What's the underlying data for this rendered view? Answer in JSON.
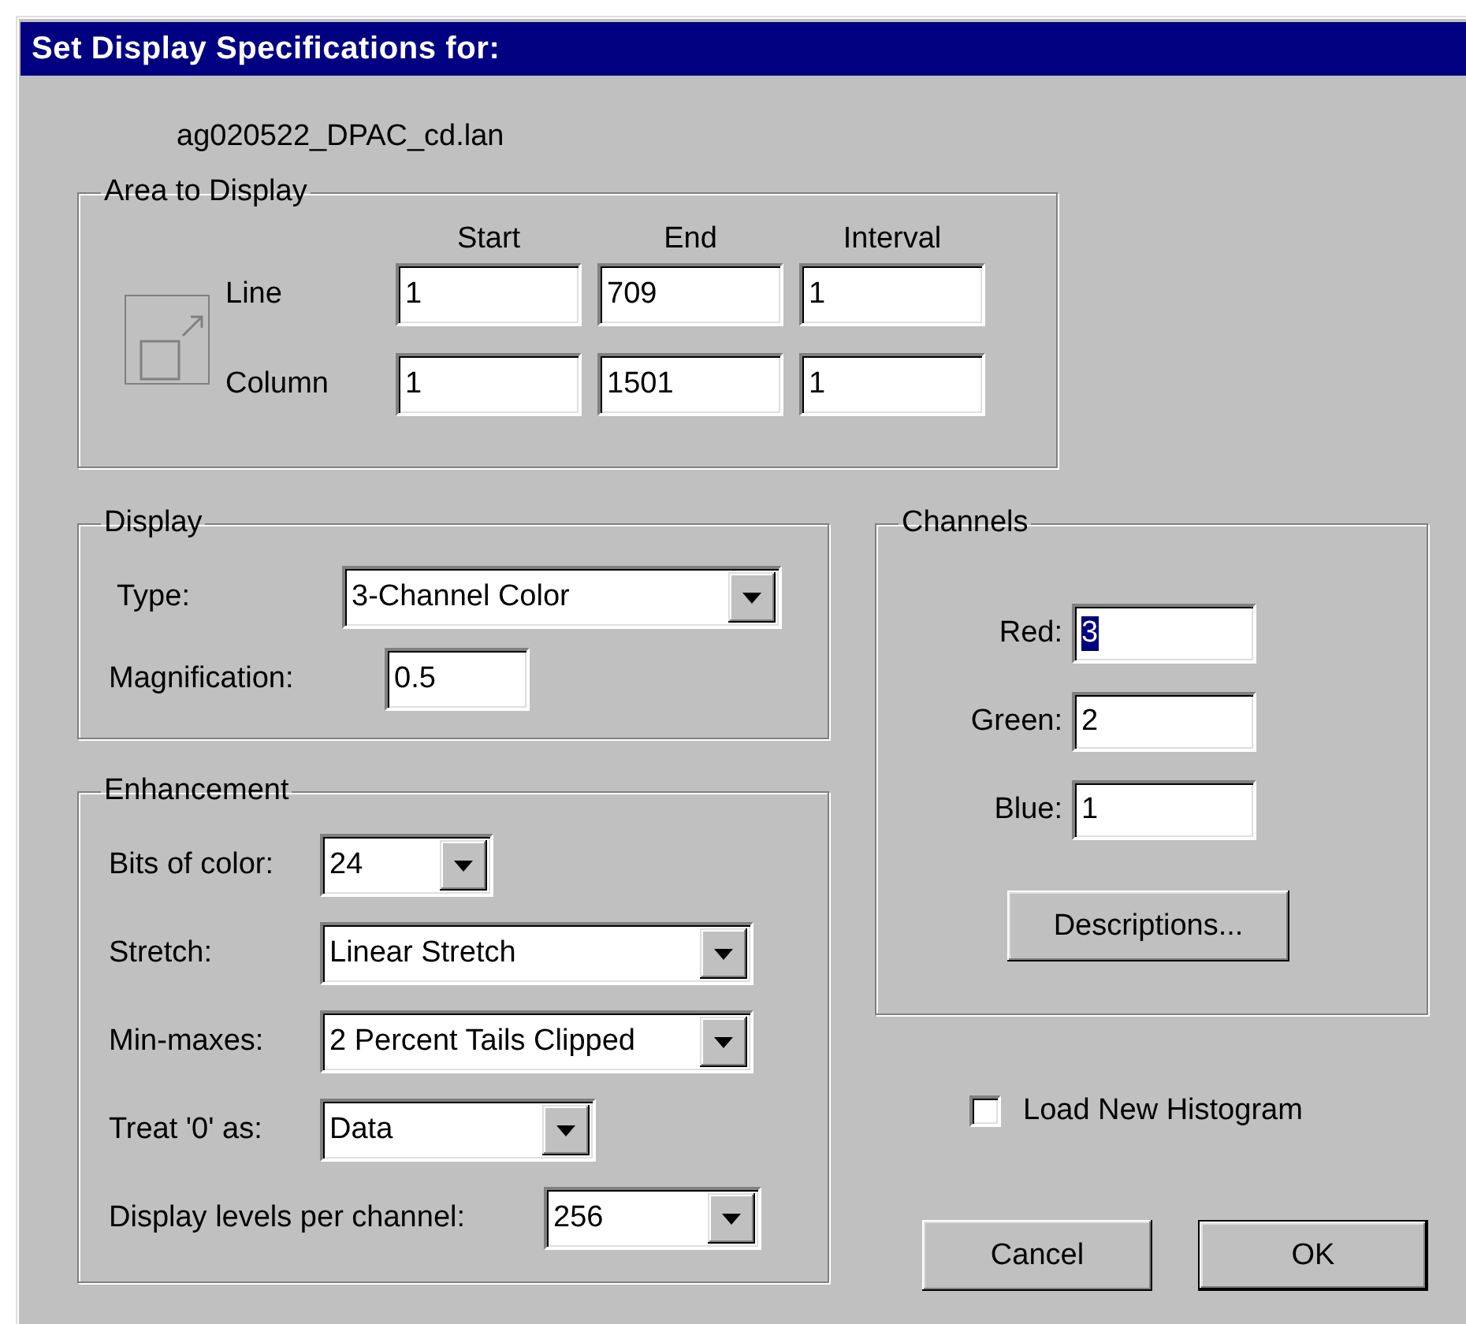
{
  "window": {
    "title": "Set Display Specifications for:"
  },
  "filename": "ag020522_DPAC_cd.lan",
  "area": {
    "title": "Area to Display",
    "columns": [
      "Start",
      "End",
      "Interval"
    ],
    "rows": [
      {
        "label": "Line",
        "values": [
          "1",
          "709",
          "1"
        ]
      },
      {
        "label": "Column",
        "values": [
          "1",
          "1501",
          "1"
        ]
      }
    ]
  },
  "display": {
    "title": "Display",
    "fields": [
      {
        "kind": "combo",
        "label": "Type:",
        "value": "3-Channel Color"
      },
      {
        "kind": "text",
        "label": "Magnification:",
        "value": "0.5"
      }
    ]
  },
  "enhancement": {
    "title": "Enhancement",
    "fields": [
      {
        "kind": "combo",
        "label": "Bits of color:",
        "value": "24"
      },
      {
        "kind": "combo",
        "label": "Stretch:",
        "value": "Linear Stretch"
      },
      {
        "kind": "combo",
        "label": "Min-maxes:",
        "value": "2 Percent Tails Clipped"
      },
      {
        "kind": "combo",
        "label": "Treat '0' as:",
        "value": "Data"
      },
      {
        "kind": "combo",
        "label": "Display levels per channel:",
        "value": "256"
      }
    ]
  },
  "channels": {
    "title": "Channels",
    "fields": [
      {
        "label": "Red:",
        "value": "3",
        "selected": true
      },
      {
        "label": "Green:",
        "value": "2",
        "selected": false
      },
      {
        "label": "Blue:",
        "value": "1",
        "selected": false
      }
    ],
    "button": "Descriptions..."
  },
  "load_new_histogram": {
    "label": "Load New Histogram",
    "checked": false
  },
  "buttons": [
    {
      "label": "Cancel",
      "default": false
    },
    {
      "label": "OK",
      "default": true
    }
  ]
}
